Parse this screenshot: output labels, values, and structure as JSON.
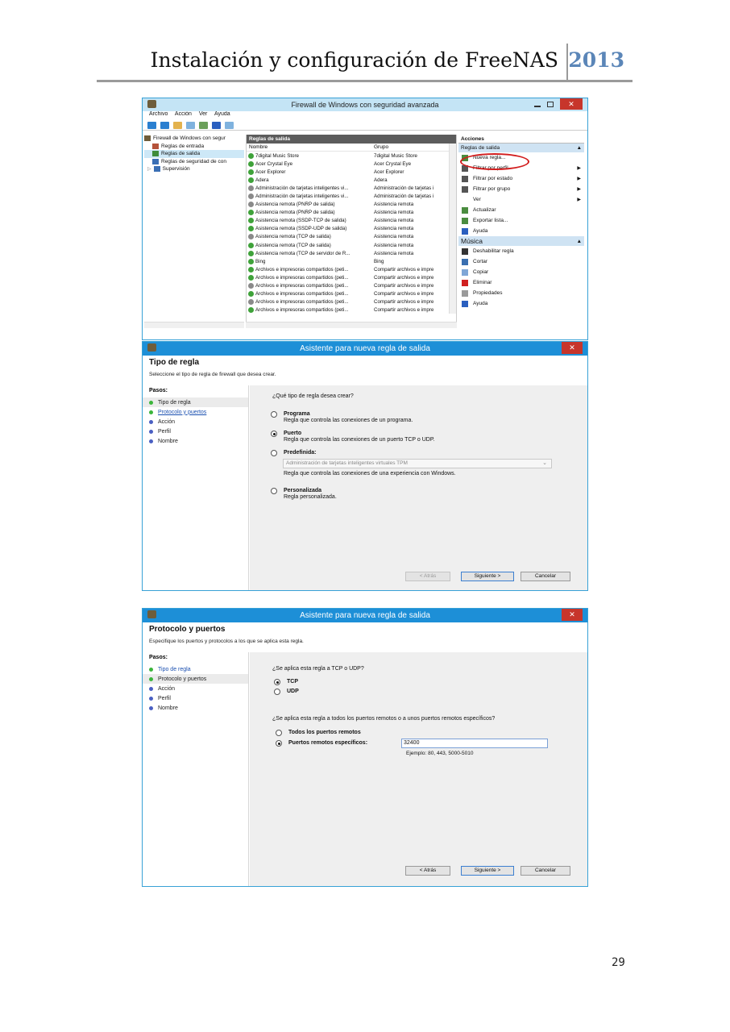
{
  "header": {
    "title": "Instalación y configuración de FreeNAS",
    "year": "2013"
  },
  "page_number": "29",
  "firewall": {
    "title": "Firewall de Windows con seguridad avanzada",
    "close": "✕",
    "menu": [
      "Archivo",
      "Acción",
      "Ver",
      "Ayuda"
    ],
    "tree": [
      "Firewall de Windows con segur",
      "Reglas de entrada",
      "Reglas de salida",
      "Reglas de seguridad de con",
      "Supervisión"
    ],
    "center_title": "Reglas de salida",
    "col_name": "Nombre",
    "col_group": "Grupo",
    "rules": [
      {
        "name": "7digital Music Store",
        "group": "7digital Music Store",
        "enabled": true
      },
      {
        "name": "Acer Crystal Eye",
        "group": "Acer Crystal Eye",
        "enabled": true
      },
      {
        "name": "Acer Explorer",
        "group": "Acer Explorer",
        "enabled": true
      },
      {
        "name": "Adera",
        "group": "Adera",
        "enabled": true
      },
      {
        "name": "Administración de tarjetas inteligentes vi...",
        "group": "Administración de tarjetas i",
        "enabled": false
      },
      {
        "name": "Administración de tarjetas inteligentes vi...",
        "group": "Administración de tarjetas i",
        "enabled": false
      },
      {
        "name": "Asistencia remota (PNRP de salida)",
        "group": "Asistencia remota",
        "enabled": false
      },
      {
        "name": "Asistencia remota (PNRP de salida)",
        "group": "Asistencia remota",
        "enabled": true
      },
      {
        "name": "Asistencia remota (SSDP-TCP de salida)",
        "group": "Asistencia remota",
        "enabled": true
      },
      {
        "name": "Asistencia remota (SSDP-UDP de salida)",
        "group": "Asistencia remota",
        "enabled": true
      },
      {
        "name": "Asistencia remota (TCP de salida)",
        "group": "Asistencia remota",
        "enabled": false
      },
      {
        "name": "Asistencia remota (TCP de salida)",
        "group": "Asistencia remota",
        "enabled": true
      },
      {
        "name": "Asistencia remota (TCP de servidor de R...",
        "group": "Asistencia remota",
        "enabled": true
      },
      {
        "name": "Bing",
        "group": "Bing",
        "enabled": true
      },
      {
        "name": "Archivos e impresoras compartidos (peti...",
        "group": "Compartir archivos e impre",
        "enabled": true
      },
      {
        "name": "Archivos e impresoras compartidos (peti...",
        "group": "Compartir archivos e impre",
        "enabled": true
      },
      {
        "name": "Archivos e impresoras compartidos (peti...",
        "group": "Compartir archivos e impre",
        "enabled": false
      },
      {
        "name": "Archivos e impresoras compartidos (peti...",
        "group": "Compartir archivos e impre",
        "enabled": true
      },
      {
        "name": "Archivos e impresoras compartidos (peti...",
        "group": "Compartir archivos e impre",
        "enabled": false
      },
      {
        "name": "Archivos e impresoras compartidos (peti...",
        "group": "Compartir archivos e impre",
        "enabled": true
      }
    ],
    "actions_title": "Acciones",
    "group1": "Reglas de salida",
    "actions1": [
      {
        "label": "Nueva regla...",
        "sub": false
      },
      {
        "label": "Filtrar por perfil",
        "sub": true
      },
      {
        "label": "Filtrar por estado",
        "sub": true
      },
      {
        "label": "Filtrar por grupo",
        "sub": true
      },
      {
        "label": "Ver",
        "sub": true
      },
      {
        "label": "Actualizar",
        "sub": false
      },
      {
        "label": "Exportar lista...",
        "sub": false
      },
      {
        "label": "Ayuda",
        "sub": false
      }
    ],
    "group2": "Música",
    "actions2": [
      "Deshabilitar regla",
      "Cortar",
      "Copiar",
      "Eliminar",
      "Propiedades",
      "Ayuda"
    ]
  },
  "wizard1": {
    "title": "Asistente para nueva regla de salida",
    "heading": "Tipo de regla",
    "subheading": "Seleccione el tipo de regla de firewall que desea crear.",
    "steps_title": "Pasos:",
    "steps": [
      "Tipo de regla",
      "Protocolo y puertos",
      "Acción",
      "Perfil",
      "Nombre"
    ],
    "question": "¿Qué tipo de regla desea crear?",
    "options": [
      {
        "title": "Programa",
        "desc": "Regla que controla las conexiones de un programa."
      },
      {
        "title": "Puerto",
        "desc": "Regla que controla las conexiones de un puerto TCP o UDP."
      },
      {
        "title": "Predefinida:",
        "desc": "Regla que controla las conexiones de una experiencia con Windows."
      },
      {
        "title": "Personalizada",
        "desc": "Regla personalizada."
      }
    ],
    "predefined_value": "Administración de tarjetas inteligentes virtuales TPM",
    "back": "< Atrás",
    "next": "Siguiente >",
    "cancel": "Cancelar"
  },
  "wizard2": {
    "title": "Asistente para nueva regla de salida",
    "heading": "Protocolo y puertos",
    "subheading": "Especifique los puertos y protocolos a los que se aplica esta regla.",
    "steps_title": "Pasos:",
    "steps": [
      "Tipo de regla",
      "Protocolo y puertos",
      "Acción",
      "Perfil",
      "Nombre"
    ],
    "question1": "¿Se aplica esta regla a TCP o UDP?",
    "tcp": "TCP",
    "udp": "UDP",
    "question2": "¿Se aplica esta regla a todos los puertos remotos o a unos puertos remotos específicos?",
    "all_ports": "Todos los puertos remotos",
    "specific_ports": "Puertos remotos específicos:",
    "port_value": "32400",
    "example": "Ejemplo: 80, 443, 5000-5010",
    "back": "< Atrás",
    "next": "Siguiente >",
    "cancel": "Cancelar"
  }
}
